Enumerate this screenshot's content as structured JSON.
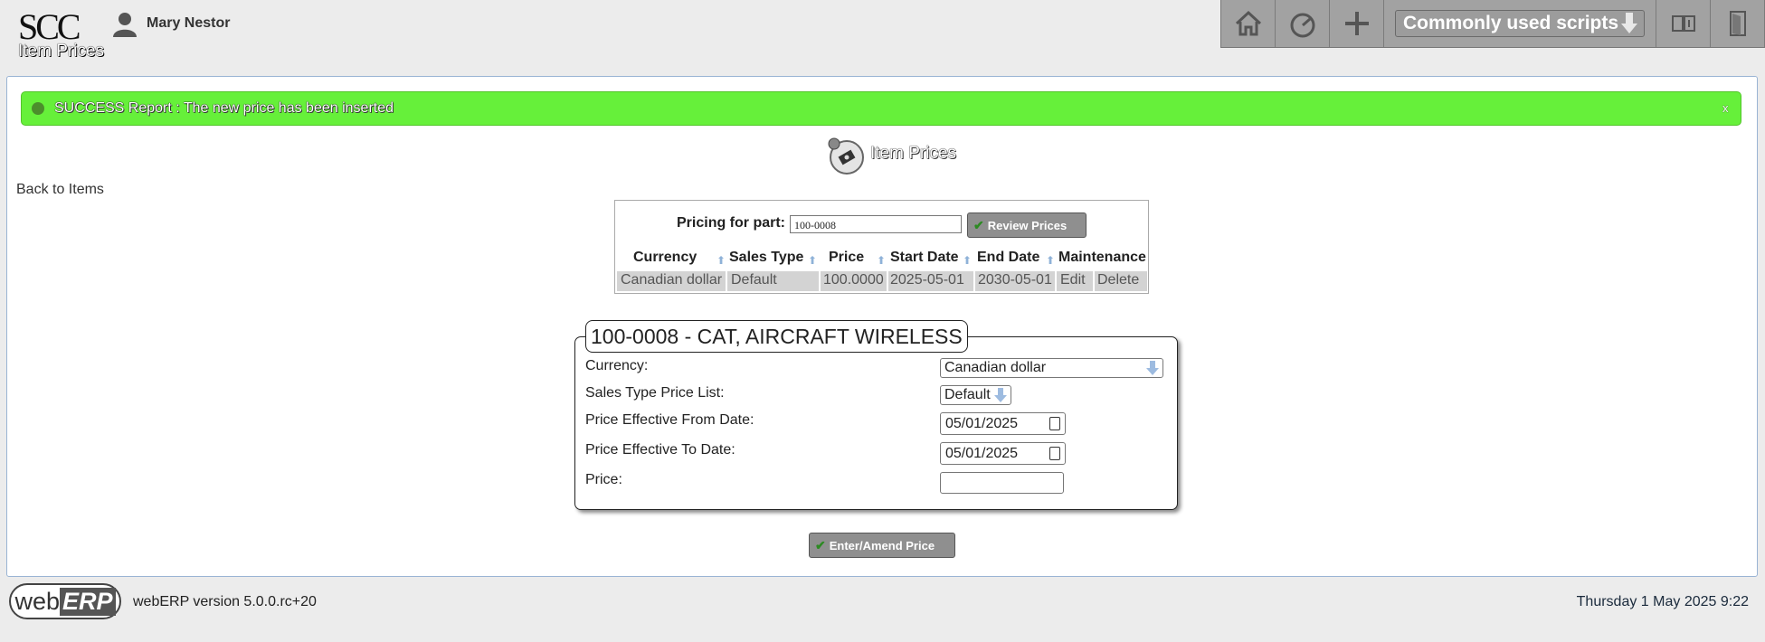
{
  "header": {
    "logo": "SCC",
    "page_subtitle": "Item Prices",
    "user_name": "Mary Nestor",
    "toolbar": {
      "icons": [
        "home-icon",
        "dashboard-icon",
        "plus-icon",
        "manual-icon",
        "logout-icon"
      ],
      "scripts_select": "Commonly used scripts"
    }
  },
  "message": {
    "text": "SUCCESS Report : The new price has been inserted",
    "close": "x"
  },
  "page": {
    "title": "Item Prices",
    "back_link": "Back to Items"
  },
  "pricing": {
    "label": "Pricing for part:",
    "part_value": "100-0008",
    "review_button": "Review Prices",
    "columns": [
      "Currency",
      "Sales Type",
      "Price",
      "Start Date",
      "End Date",
      "Maintenance"
    ],
    "rows": [
      {
        "currency": "Canadian dollar",
        "sales_type": "Default",
        "price": "100.0000",
        "start_date": "2025-05-01",
        "end_date": "2030-05-01",
        "edit": "Edit",
        "delete": "Delete"
      }
    ]
  },
  "form": {
    "legend": "100-0008 - CAT, AIRCRAFT WIRELESS",
    "currency_label": "Currency:",
    "currency_value": "Canadian dollar",
    "sales_type_label": "Sales Type Price List:",
    "sales_type_value": "Default",
    "from_label": "Price Effective From Date:",
    "from_value": "05/01/2025",
    "to_label": "Price Effective To Date:",
    "to_value": "05/01/2025",
    "price_label": "Price:",
    "price_value": "",
    "submit": "Enter/Amend Price"
  },
  "footer": {
    "logo_a": "web",
    "logo_b": "ERP",
    "version": "webERP version 5.0.0.rc+20",
    "datetime": "Thursday 1 May 2025 9:22"
  },
  "colors": {
    "success_bg": "#66f03a",
    "toolbar_bg": "#a2a2a2",
    "button_bg": "#8f8f8f",
    "panel_border": "#9ab4d4"
  }
}
